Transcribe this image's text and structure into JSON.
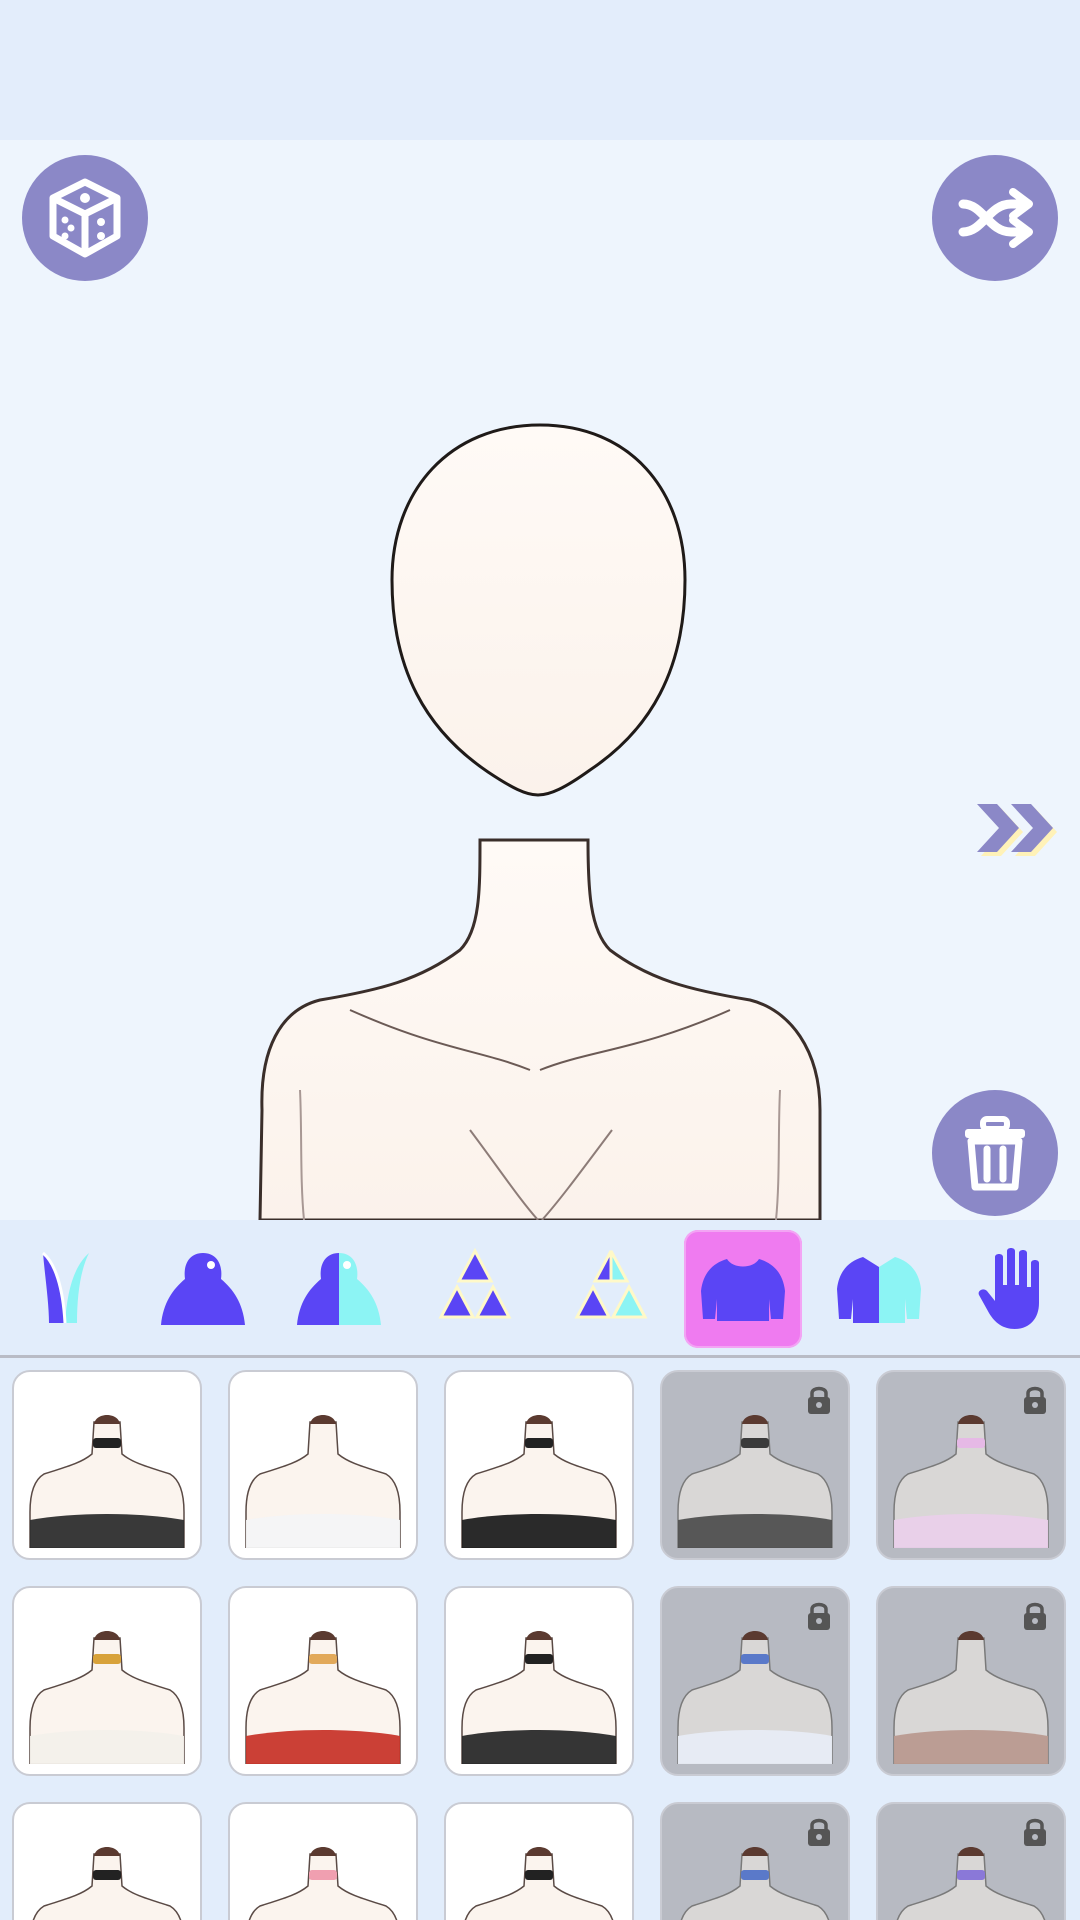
{
  "app": {
    "screen": "outfit-editor",
    "accent": "#5a45f5",
    "button_bg": "#8b88c7",
    "active_tab_bg": "#ef7bf0"
  },
  "stage": {
    "actions": [
      {
        "name": "random-dice",
        "icon": "dice-icon"
      },
      {
        "name": "shuffle",
        "icon": "shuffle-icon"
      },
      {
        "name": "next",
        "icon": "double-chevron-right-icon"
      },
      {
        "name": "delete",
        "icon": "trash-icon"
      }
    ]
  },
  "categories": [
    {
      "icon": "bunny-ears-icon",
      "active": false
    },
    {
      "icon": "body-icon",
      "active": false
    },
    {
      "icon": "half-body-icon",
      "active": false
    },
    {
      "icon": "triforce-icon",
      "active": false
    },
    {
      "icon": "triforce-split-icon",
      "active": false
    },
    {
      "icon": "top-shirt-icon",
      "active": true
    },
    {
      "icon": "jacket-icon",
      "active": false
    },
    {
      "icon": "hand-glove-icon",
      "active": false
    }
  ],
  "items": [
    {
      "id": 1,
      "locked": false,
      "style": "black-choker-offshoulder"
    },
    {
      "id": 2,
      "locked": false,
      "style": "white-wrap"
    },
    {
      "id": 3,
      "locked": false,
      "style": "black-strap-bikini"
    },
    {
      "id": 4,
      "locked": true,
      "style": "fur-collar"
    },
    {
      "id": 5,
      "locked": true,
      "style": "pink-high-collar"
    },
    {
      "id": 6,
      "locked": false,
      "style": "egyptian-collar"
    },
    {
      "id": 7,
      "locked": false,
      "style": "red-sash-halter"
    },
    {
      "id": 8,
      "locked": false,
      "style": "pentagram-harness"
    },
    {
      "id": 9,
      "locked": true,
      "style": "blue-ribbon-lace"
    },
    {
      "id": 10,
      "locked": true,
      "style": "plaid-red-bow"
    },
    {
      "id": 11,
      "locked": false,
      "style": "black-ribbon"
    },
    {
      "id": 12,
      "locked": false,
      "style": "pink-bow"
    },
    {
      "id": 13,
      "locked": false,
      "style": "spiked-collar"
    },
    {
      "id": 14,
      "locked": true,
      "style": "blue-lace"
    },
    {
      "id": 15,
      "locked": true,
      "style": "purple-collar"
    }
  ]
}
